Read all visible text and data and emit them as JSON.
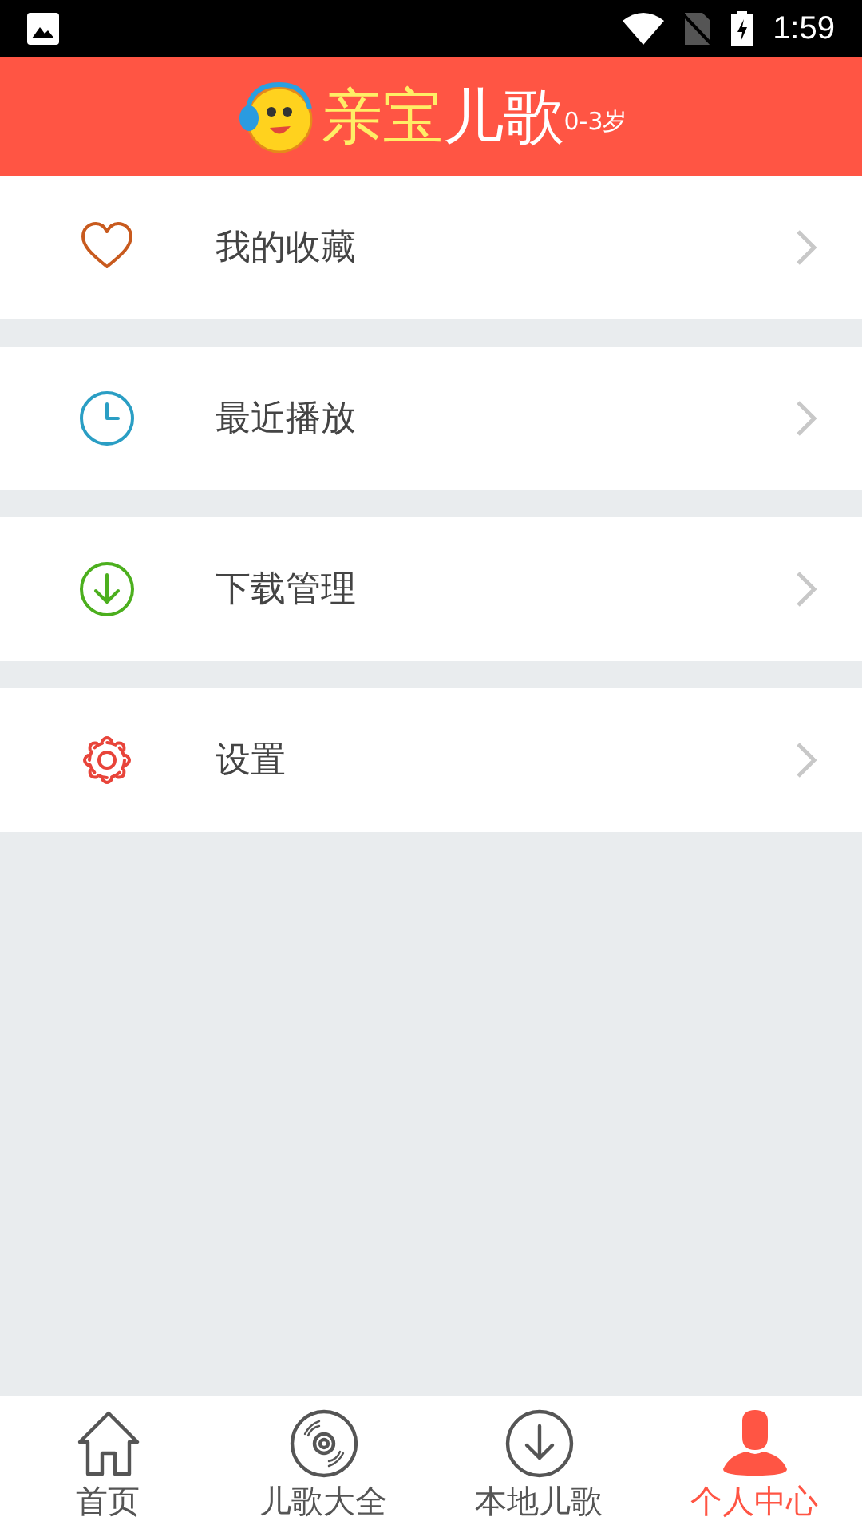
{
  "status_bar": {
    "time": "1:59"
  },
  "header": {
    "title_parts": [
      {
        "text": "亲宝",
        "kind": "main",
        "color": "#ffee66"
      },
      {
        "text": "儿歌",
        "kind": "main",
        "color": "#ffffff"
      },
      {
        "text": "0-3岁",
        "kind": "small",
        "color": "#ffffff"
      }
    ]
  },
  "menu": [
    {
      "label": "我的收藏",
      "kind": "heart",
      "color": "#c85a1e"
    },
    {
      "label": "最近播放",
      "kind": "clock",
      "color": "#2a9ec4"
    },
    {
      "label": "下载管理",
      "kind": "download",
      "color": "#4caf1e"
    },
    {
      "label": "设置",
      "kind": "gear",
      "color": "#e8443a"
    }
  ],
  "tabs": [
    {
      "label": "首页",
      "kind": "home",
      "selected": false
    },
    {
      "label": "儿歌大全",
      "kind": "disc",
      "selected": false
    },
    {
      "label": "本地儿歌",
      "kind": "download",
      "selected": false
    },
    {
      "label": "个人中心",
      "kind": "person",
      "selected": true
    }
  ]
}
